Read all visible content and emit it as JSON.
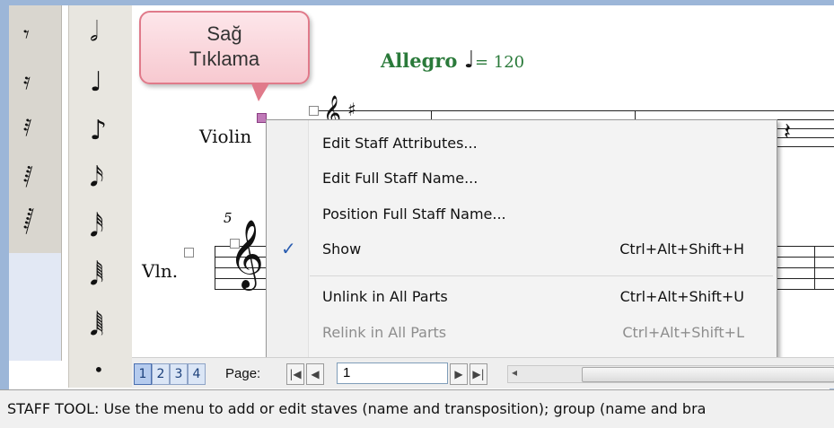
{
  "callout": {
    "line1": "Sağ",
    "line2": "Tıklama"
  },
  "score": {
    "tempo_text": "Allegro",
    "tempo_note": "♩",
    "tempo_value": "= 120",
    "staff_name_full": "Violin",
    "staff_name_short": "Vln.",
    "measure_number": "5"
  },
  "context_menu": {
    "items": [
      {
        "label": "Edit Staff Attributes...",
        "shortcut": "",
        "checked": false,
        "disabled": false
      },
      {
        "label": "Edit Full Staff Name...",
        "shortcut": "",
        "checked": false,
        "disabled": false
      },
      {
        "label": "Position Full Staff Name...",
        "shortcut": "",
        "checked": false,
        "disabled": false
      },
      {
        "label": "Show",
        "shortcut": "Ctrl+Alt+Shift+H",
        "checked": true,
        "disabled": false
      },
      {
        "label": "Unlink in All Parts",
        "shortcut": "Ctrl+Alt+Shift+U",
        "checked": false,
        "disabled": false
      },
      {
        "label": "Relink in All Parts",
        "shortcut": "Ctrl+Alt+Shift+L",
        "checked": false,
        "disabled": true
      }
    ],
    "check_glyph": "✓"
  },
  "pager": {
    "page_buttons": [
      "1",
      "2",
      "3",
      "4"
    ],
    "active_page_button": "1",
    "page_label": "Page:",
    "page_value": "1"
  },
  "palette": {
    "rests": [
      "𝄾",
      "𝄿",
      "𝅀",
      "𝅁",
      "𝅂"
    ],
    "notes": [
      "𝅗𝅥",
      "♩",
      "♪",
      "𝅘𝅥𝅯",
      "𝅘𝅥𝅰",
      "𝅘𝅥𝅱",
      "𝅘𝅥𝅲",
      "•"
    ]
  },
  "status_bar": {
    "text": "STAFF TOOL: Use the menu to add or edit staves (name and transposition); group (name and bra"
  },
  "colors": {
    "tempo": "#2a7a3a",
    "callout_border": "#e07a8a",
    "selected_handle": "#c07ab8",
    "check": "#2a5db0"
  }
}
